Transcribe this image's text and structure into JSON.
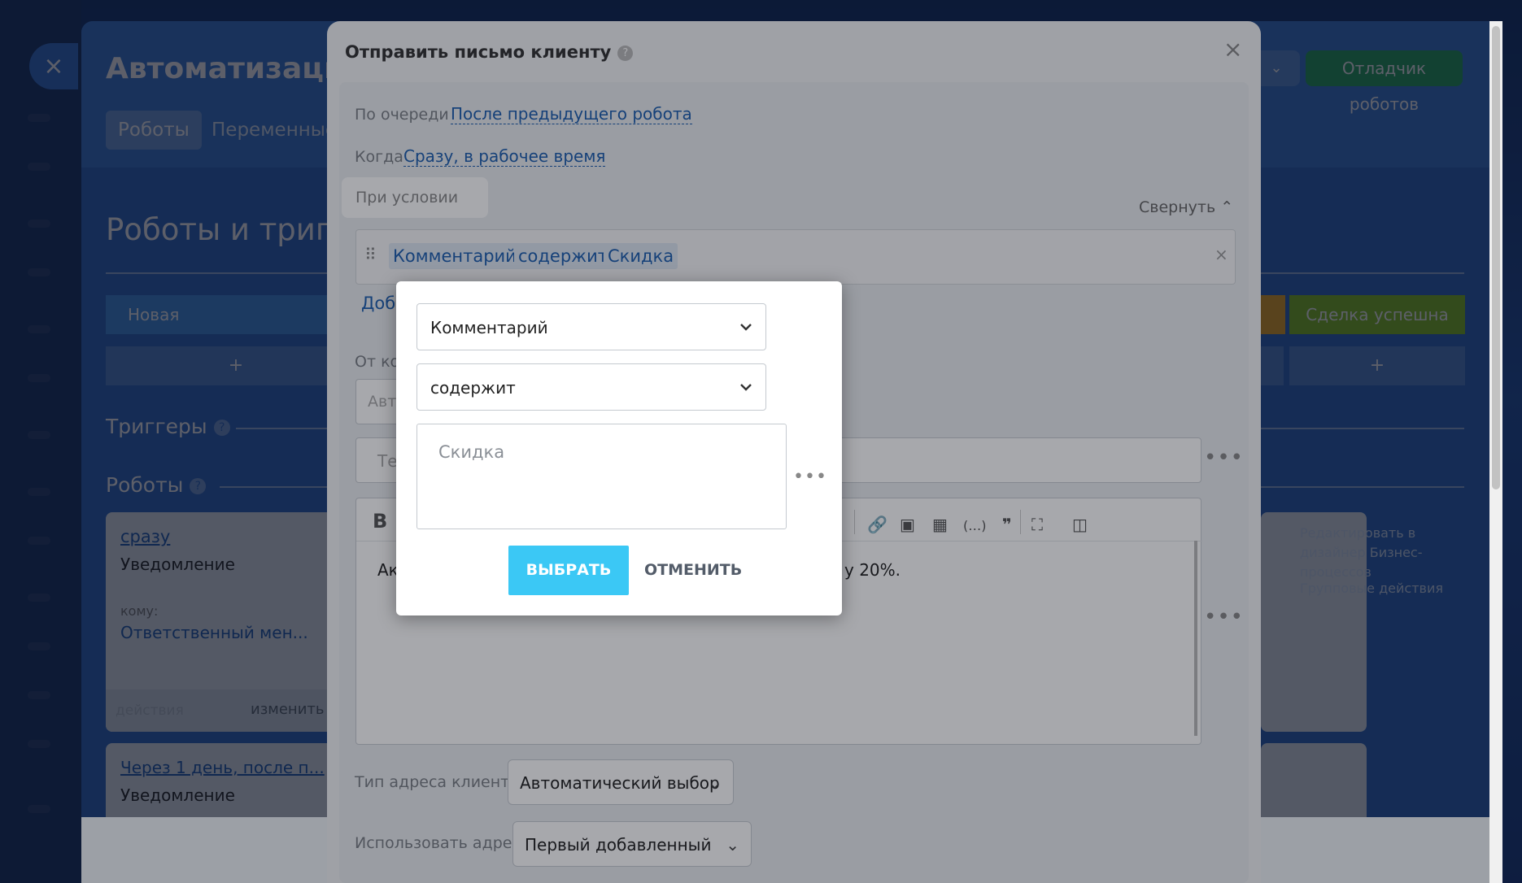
{
  "background": {
    "close_icon": "×",
    "title": "Автоматизация",
    "tabs": [
      "Роботы",
      "Переменные"
    ],
    "debug_button": "Отладчик роботов",
    "section_title": "Роботы и тригг",
    "stage_new": "Новая",
    "stage_success": "Сделка успешна",
    "plus": "+",
    "triggers_title": "Триггеры",
    "robots_title": "Роботы",
    "help": "?",
    "card1": {
      "when": "сразу",
      "type": "Уведомление",
      "to_label": "кому:",
      "to_value": "Ответственный мен...",
      "actions": "действия",
      "edit": "изменить"
    },
    "card2": {
      "when": "Через 1 день, после п...",
      "type": "Уведомление"
    },
    "side_links": [
      "Редактировать в дизайнер Бизнес-процессов",
      "Групповые действия"
    ]
  },
  "dialog": {
    "title": "Отправить письмо клиенту",
    "help": "?",
    "close": "×",
    "order_label": "По очереди",
    "order_value": "После предыдущего робота",
    "when_label": "Когда",
    "when_value": "Сразу, в рабочее время",
    "condition_label": "При условии",
    "collapse": "Свернуть",
    "condition": {
      "field": "Комментарий",
      "operator": "содержит",
      "value": "Скидка"
    },
    "add_partial": "Доб",
    "from_partial": "От ко",
    "from_input_partial": "Авт",
    "subject_partial": "Те",
    "editor_text_start": "Ак",
    "editor_text_end": "у 20%.",
    "editor_bold": "B",
    "address_type_label": "Тип адреса клиента:",
    "address_type_value": "Автоматический выбор",
    "use_address_label": "Использовать адрес:",
    "use_address_value": "Первый добавленный",
    "more": "•••"
  },
  "popup": {
    "field_select": "Комментарий",
    "operator_select": "содержит",
    "value_placeholder": "Скидка",
    "more": "•••",
    "ok_button": "ВЫБРАТЬ",
    "cancel_button": "ОТМЕНИТЬ"
  },
  "colors": {
    "accent_blue": "#3bc8f5",
    "debug_green": "#20a55d",
    "stage_success": "#82c21a",
    "link_blue": "#1d5fb0"
  }
}
